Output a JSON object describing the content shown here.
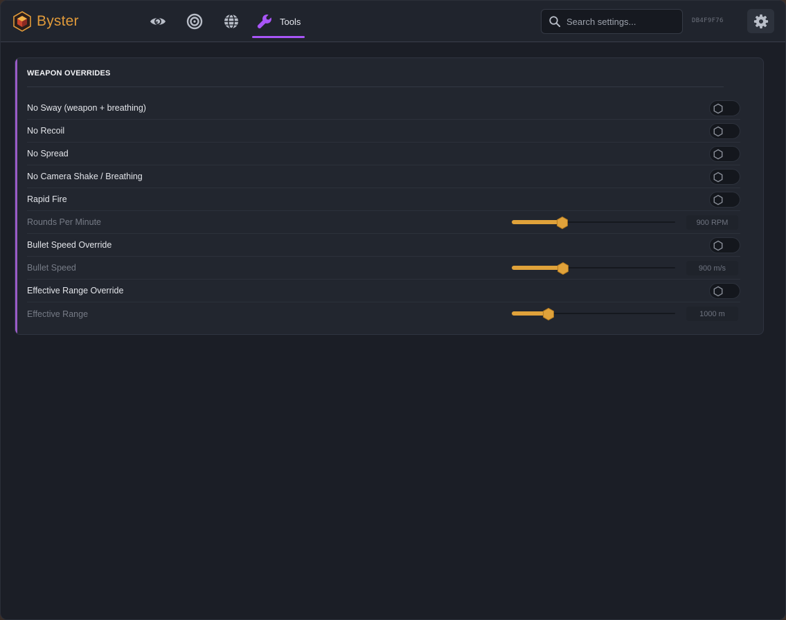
{
  "app": {
    "name": "Byster"
  },
  "nav": {
    "items": [
      {
        "icon": "eye-icon"
      },
      {
        "icon": "target-icon"
      },
      {
        "icon": "globe-icon"
      },
      {
        "icon": "wrench-icon",
        "label": "Tools",
        "active": true
      }
    ]
  },
  "search": {
    "placeholder": "Search settings..."
  },
  "device_id": "DB4F9F76",
  "panel": {
    "title": "WEAPON OVERRIDES",
    "rows": [
      {
        "label": "No Sway (weapon + breathing)",
        "type": "toggle",
        "on": false
      },
      {
        "label": "No Recoil",
        "type": "toggle",
        "on": false
      },
      {
        "label": "No Spread",
        "type": "toggle",
        "on": false
      },
      {
        "label": "No Camera Shake / Breathing",
        "type": "toggle",
        "on": false
      },
      {
        "label": "Rapid Fire",
        "type": "toggle",
        "on": false
      },
      {
        "label": "Rounds Per Minute",
        "type": "slider",
        "value_text": "900 RPM",
        "fraction": 0.31
      },
      {
        "label": "Bullet Speed Override",
        "type": "toggle",
        "on": false
      },
      {
        "label": "Bullet Speed",
        "type": "slider",
        "value_text": "900 m/s",
        "fraction": 0.315
      },
      {
        "label": "Effective Range Override",
        "type": "toggle",
        "on": false
      },
      {
        "label": "Effective Range",
        "type": "slider",
        "value_text": "1000 m",
        "fraction": 0.225
      }
    ]
  },
  "colors": {
    "accent_purple": "#a855f7",
    "accent_orange": "#e0a23a",
    "background": "#1b1e26"
  }
}
